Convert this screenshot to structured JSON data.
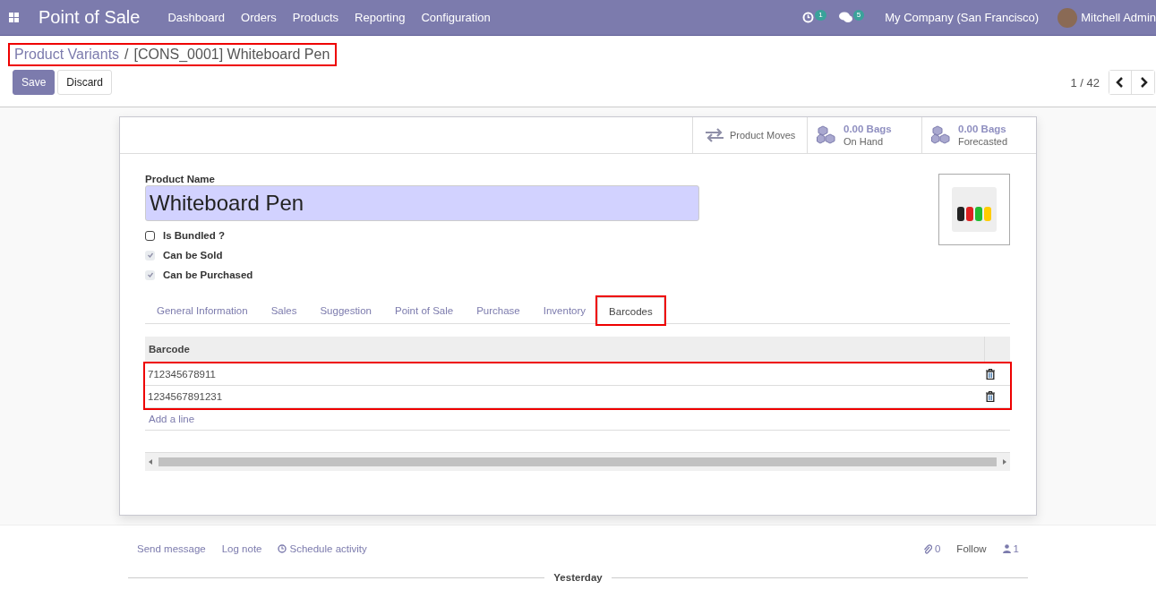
{
  "navbar": {
    "app_name": "Point of Sale",
    "menu": [
      "Dashboard",
      "Orders",
      "Products",
      "Reporting",
      "Configuration"
    ],
    "activity_count": "1",
    "message_count": "5",
    "company": "My Company (San Francisco)",
    "user": "Mitchell Admin"
  },
  "breadcrumb": {
    "parent": "Product Variants",
    "separator": "/",
    "current": "[CONS_0001] Whiteboard Pen",
    "highlighted": true
  },
  "buttons": {
    "save": "Save",
    "discard": "Discard"
  },
  "pager": {
    "value": "1 / 42"
  },
  "smart_buttons": [
    {
      "kind": "moves",
      "label": "Product Moves"
    },
    {
      "kind": "stock",
      "value": "0.00 Bags",
      "label": "On Hand"
    },
    {
      "kind": "stock",
      "value": "0.00 Bags",
      "label": "Forecasted"
    }
  ],
  "form": {
    "name_label": "Product Name",
    "name_value": "Whiteboard Pen",
    "checkboxes": [
      {
        "label": "Is Bundled ?",
        "checked": false,
        "disabled": false
      },
      {
        "label": "Can be Sold",
        "checked": true,
        "disabled": true
      },
      {
        "label": "Can be Purchased",
        "checked": true,
        "disabled": true
      }
    ]
  },
  "tabs": [
    {
      "label": "General Information",
      "selected": false,
      "highlighted": false
    },
    {
      "label": "Sales",
      "selected": false,
      "highlighted": false
    },
    {
      "label": "Suggestion",
      "selected": false,
      "highlighted": false
    },
    {
      "label": "Point of Sale",
      "selected": false,
      "highlighted": false
    },
    {
      "label": "Purchase",
      "selected": false,
      "highlighted": false
    },
    {
      "label": "Inventory",
      "selected": false,
      "highlighted": false
    },
    {
      "label": "Barcodes",
      "selected": true,
      "highlighted": true
    }
  ],
  "table": {
    "columns": [
      "Barcode"
    ],
    "rows_highlighted": true,
    "rows": [
      {
        "barcode": "712345678911"
      },
      {
        "barcode": "1234567891231"
      }
    ],
    "add_line": "Add a line"
  },
  "chatter": {
    "send_message": "Send message",
    "log_note": "Log note",
    "schedule_activity": "Schedule activity",
    "attachments": "0",
    "follow": "Follow",
    "followers": "1",
    "date_separator": "Yesterday"
  }
}
